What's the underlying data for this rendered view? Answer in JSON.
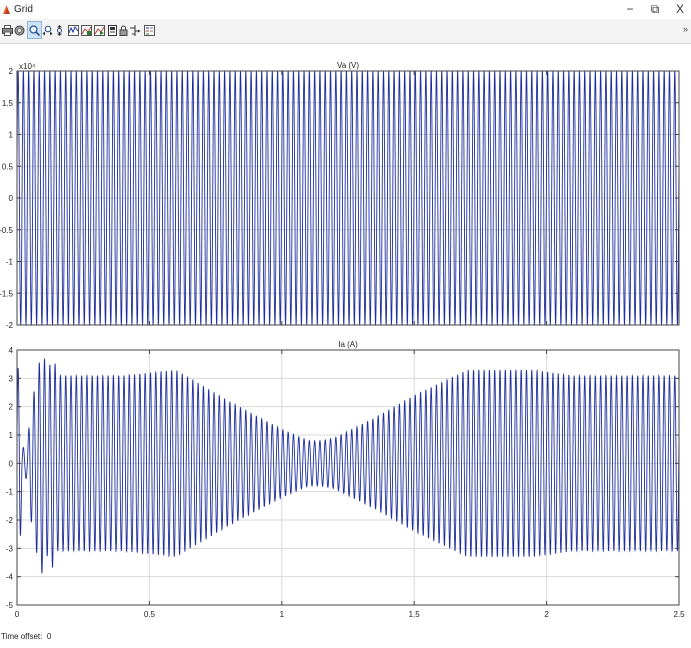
{
  "window": {
    "title": "Grid",
    "minimize": "−",
    "restore": "⧉",
    "close": "X"
  },
  "toolbar": {
    "buttons": [
      {
        "icon": "print-icon"
      },
      {
        "icon": "parameters-icon"
      },
      {
        "icon": "zoom-in-icon",
        "selected": true
      },
      {
        "icon": "zoom-x-icon"
      },
      {
        "icon": "zoom-y-icon"
      },
      {
        "icon": "autoscale-icon"
      },
      {
        "icon": "save-axes-icon"
      },
      {
        "icon": "restore-axes-icon"
      },
      {
        "icon": "floating-scope-icon"
      },
      {
        "icon": "lock-axes-icon"
      },
      {
        "icon": "signal-selection-icon"
      },
      {
        "icon": "legend-icon"
      }
    ],
    "overflow": "»"
  },
  "chart_data": [
    {
      "type": "line",
      "title": "Va (V)",
      "xlabel": "",
      "ylabel": "",
      "exponent_label": "x10⁴",
      "xlim": [
        0,
        2.5
      ],
      "ylim": [
        -2,
        2
      ],
      "x_ticks": [
        0,
        0.5,
        1,
        1.5,
        2,
        2.5
      ],
      "y_ticks": [
        -2,
        -1.5,
        -1,
        -0.5,
        0,
        0.5,
        1,
        1.5,
        2
      ],
      "grid": true,
      "line_color": "#1f2f9e",
      "series": [
        {
          "waveform": "sine",
          "frequency_hz": 50,
          "envelope_x": [
            0,
            2.5
          ],
          "envelope_y": [
            2,
            2
          ]
        }
      ]
    },
    {
      "type": "line",
      "title": "Ia (A)",
      "xlabel": "",
      "ylabel": "",
      "xlim": [
        0,
        2.5
      ],
      "ylim": [
        -5,
        4
      ],
      "x_ticks": [
        0,
        0.5,
        1,
        1.5,
        2,
        2.5
      ],
      "y_ticks": [
        -5,
        -4,
        -3,
        -2,
        -1,
        0,
        1,
        2,
        3,
        4
      ],
      "grid": true,
      "line_color": "#1f2f9e",
      "series": [
        {
          "waveform": "sine",
          "frequency_hz": 50,
          "envelope_x": [
            0.15,
            0.4,
            0.6,
            0.8,
            1.0,
            1.1,
            1.15,
            1.2,
            1.35,
            1.5,
            1.7,
            1.95,
            2.1,
            2.5
          ],
          "envelope_y": [
            3.1,
            3.1,
            3.3,
            2.2,
            1.2,
            0.8,
            0.8,
            0.9,
            1.6,
            2.4,
            3.3,
            3.3,
            3.1,
            3.1
          ],
          "transient": {
            "t": [
              0,
              0.01,
              0.02,
              0.03,
              0.04,
              0.05,
              0.06,
              0.07,
              0.08,
              0.09,
              0.1,
              0.11,
              0.12,
              0.13,
              0.14,
              0.15
            ],
            "amplitude": [
              3.2,
              3.6,
              0.6,
              0.5,
              0.6,
              2.0,
              2.2,
              3.0,
              3.4,
              3.8,
              4.0,
              3.2,
              3.4,
              3.6,
              3.8,
              3.1
            ]
          }
        }
      ]
    }
  ],
  "status": {
    "time_offset_label": "Time offset:",
    "time_offset_value": "0"
  }
}
